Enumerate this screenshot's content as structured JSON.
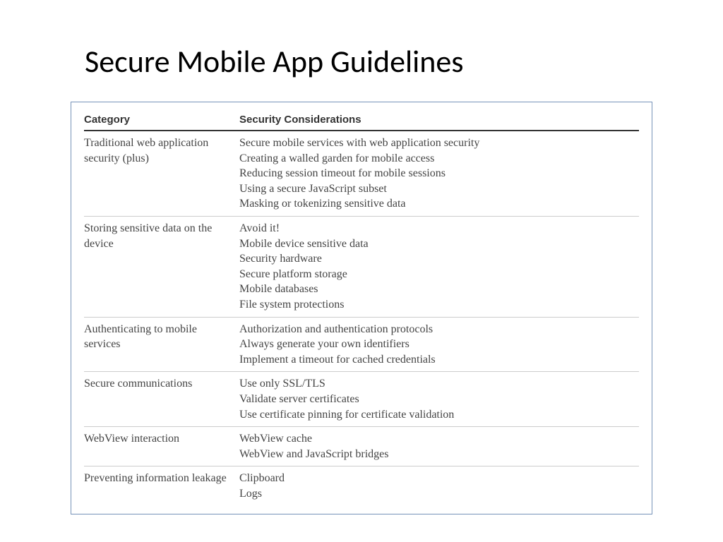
{
  "title": "Secure Mobile App Guidelines",
  "headers": {
    "category": "Category",
    "considerations": "Security Considerations"
  },
  "rows": [
    {
      "category": "Traditional web application security (plus)",
      "items": [
        "Secure mobile services with web application security",
        "Creating a walled garden for mobile access",
        "Reducing session timeout for mobile sessions",
        "Using a secure JavaScript subset",
        "Masking or tokenizing sensitive data"
      ]
    },
    {
      "category": "Storing sensitive data on the device",
      "items": [
        "Avoid it!",
        "Mobile device sensitive data",
        "Security hardware",
        "Secure platform storage",
        "Mobile databases",
        "File system protections"
      ]
    },
    {
      "category": "Authenticating to mobile services",
      "items": [
        "Authorization and authentication protocols",
        "Always generate your own identifiers",
        "Implement a timeout for cached credentials"
      ]
    },
    {
      "category": "Secure communications",
      "items": [
        "Use only SSL/TLS",
        "Validate server certificates",
        "Use certificate pinning for certificate validation"
      ]
    },
    {
      "category": "WebView interaction",
      "items": [
        "WebView cache",
        "WebView and JavaScript bridges"
      ]
    },
    {
      "category": "Preventing information leakage",
      "items": [
        "Clipboard",
        "Logs"
      ]
    }
  ]
}
